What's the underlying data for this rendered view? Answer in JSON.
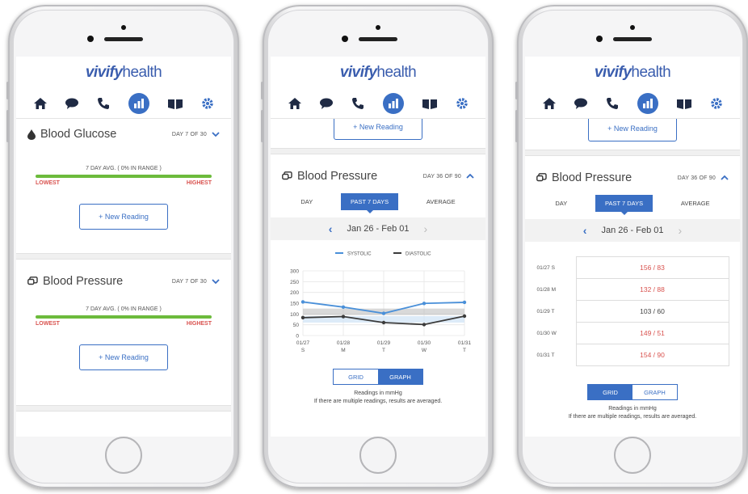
{
  "brand": {
    "logo_v": "vivify",
    "logo_h": "health"
  },
  "nav": [
    "home-icon",
    "chat-icon",
    "phone-icon",
    "chart-icon",
    "book-icon",
    "gear-icon"
  ],
  "colors": {
    "accent": "#3a6fc4",
    "in_range": "#6cbb3c",
    "alert": "#d9534f",
    "systolic": "#4a90d9",
    "diastolic": "#3b3b3b"
  },
  "phone1": {
    "glucose": {
      "title": "Blood Glucose",
      "day": "DAY 7 OF 30",
      "avg": "7 DAY AVG. ( 0% IN RANGE )",
      "lowest": "LOWEST",
      "highest": "HIGHEST",
      "button": "+ New Reading"
    },
    "pressure": {
      "title": "Blood Pressure",
      "day": "DAY 7 OF 30",
      "avg": "7 DAY AVG. ( 0% IN RANGE )",
      "lowest": "LOWEST",
      "highest": "HIGHEST",
      "button": "+ New Reading"
    }
  },
  "phone2": {
    "button": "+ New Reading",
    "title": "Blood Pressure",
    "day": "DAY 36 OF 90",
    "tabs": [
      "DAY",
      "PAST 7 DAYS",
      "AVERAGE"
    ],
    "range": "Jan 26 - Feb 01",
    "toggle": [
      "GRID",
      "GRAPH"
    ],
    "note1": "Readings in mmHg",
    "note2": "If there are multiple readings, results are averaged."
  },
  "phone3": {
    "button": "+ New Reading",
    "title": "Blood Pressure",
    "day": "DAY 36 OF 90",
    "tabs": [
      "DAY",
      "PAST 7 DAYS",
      "AVERAGE"
    ],
    "range": "Jan 26 - Feb 01",
    "rows": [
      {
        "label": "01/27 S",
        "value": "156 / 83"
      },
      {
        "label": "01/28 M",
        "value": "132 / 88"
      },
      {
        "label": "01/29 T",
        "value": "103 / 60"
      },
      {
        "label": "01/30 W",
        "value": "149 / 51"
      },
      {
        "label": "01/31 T",
        "value": "154 / 90"
      }
    ],
    "toggle": [
      "GRID",
      "GRAPH"
    ],
    "note1": "Readings in mmHg",
    "note2": "If there are multiple readings, results are averaged."
  },
  "chart_data": {
    "type": "line",
    "categories": [
      "01/27",
      "01/28",
      "01/29",
      "01/30",
      "01/31"
    ],
    "weekdays": [
      "S",
      "M",
      "T",
      "W",
      "T"
    ],
    "yticks": [
      300,
      250,
      200,
      150,
      100,
      50,
      0
    ],
    "ylim": [
      0,
      300
    ],
    "target_band": [
      95,
      125
    ],
    "series": [
      {
        "name": "SYSTOLIC",
        "values": [
          156,
          132,
          103,
          149,
          154
        ]
      },
      {
        "name": "DIASTOLIC",
        "values": [
          83,
          88,
          60,
          51,
          90
        ]
      }
    ]
  }
}
